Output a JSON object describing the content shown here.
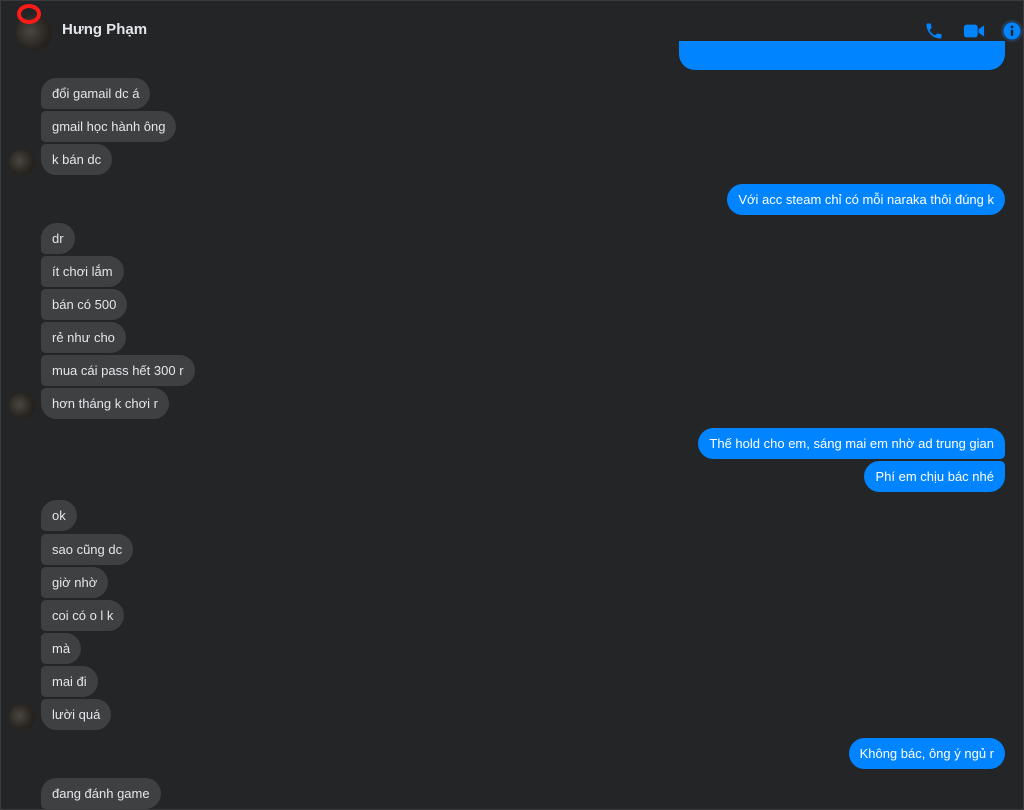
{
  "contact": {
    "name": "Hưng Phạm"
  },
  "header_icons": {
    "call": "phone-icon",
    "video": "video-camera-icon",
    "info": "info-icon"
  },
  "colors": {
    "accent": "#0084ff",
    "incoming_bubble": "#3e4042",
    "background": "#242526",
    "online_ring": "#ff1a1a"
  },
  "messages": [
    {
      "side": "in",
      "text": "đổi gamail dc á"
    },
    {
      "side": "in",
      "text": "gmail học hành ông"
    },
    {
      "side": "in",
      "text": "k bán dc"
    },
    {
      "side": "out",
      "text": "Với acc steam chỉ có mỗi naraka thôi đúng k"
    },
    {
      "side": "in",
      "text": "dr"
    },
    {
      "side": "in",
      "text": "ít chơi lắm"
    },
    {
      "side": "in",
      "text": "bán có 500"
    },
    {
      "side": "in",
      "text": "rẻ như cho"
    },
    {
      "side": "in",
      "text": "mua cái pass hết 300 r"
    },
    {
      "side": "in",
      "text": "hơn tháng k chơi r"
    },
    {
      "side": "out",
      "text": "Thế hold cho em, sáng mai em nhờ ad trung gian"
    },
    {
      "side": "out",
      "text": "Phí em chịu bác nhé"
    },
    {
      "side": "in",
      "text": "ok"
    },
    {
      "side": "in",
      "text": "sao cũng dc"
    },
    {
      "side": "in",
      "text": "giờ nhờ"
    },
    {
      "side": "in",
      "text": "coi có o l k"
    },
    {
      "side": "in",
      "text": "mà"
    },
    {
      "side": "in",
      "text": "mai đi"
    },
    {
      "side": "in",
      "text": "lười quá"
    },
    {
      "side": "out",
      "text": "Không bác, ông ý ngủ r"
    },
    {
      "side": "in",
      "text": "đang đánh game"
    }
  ]
}
